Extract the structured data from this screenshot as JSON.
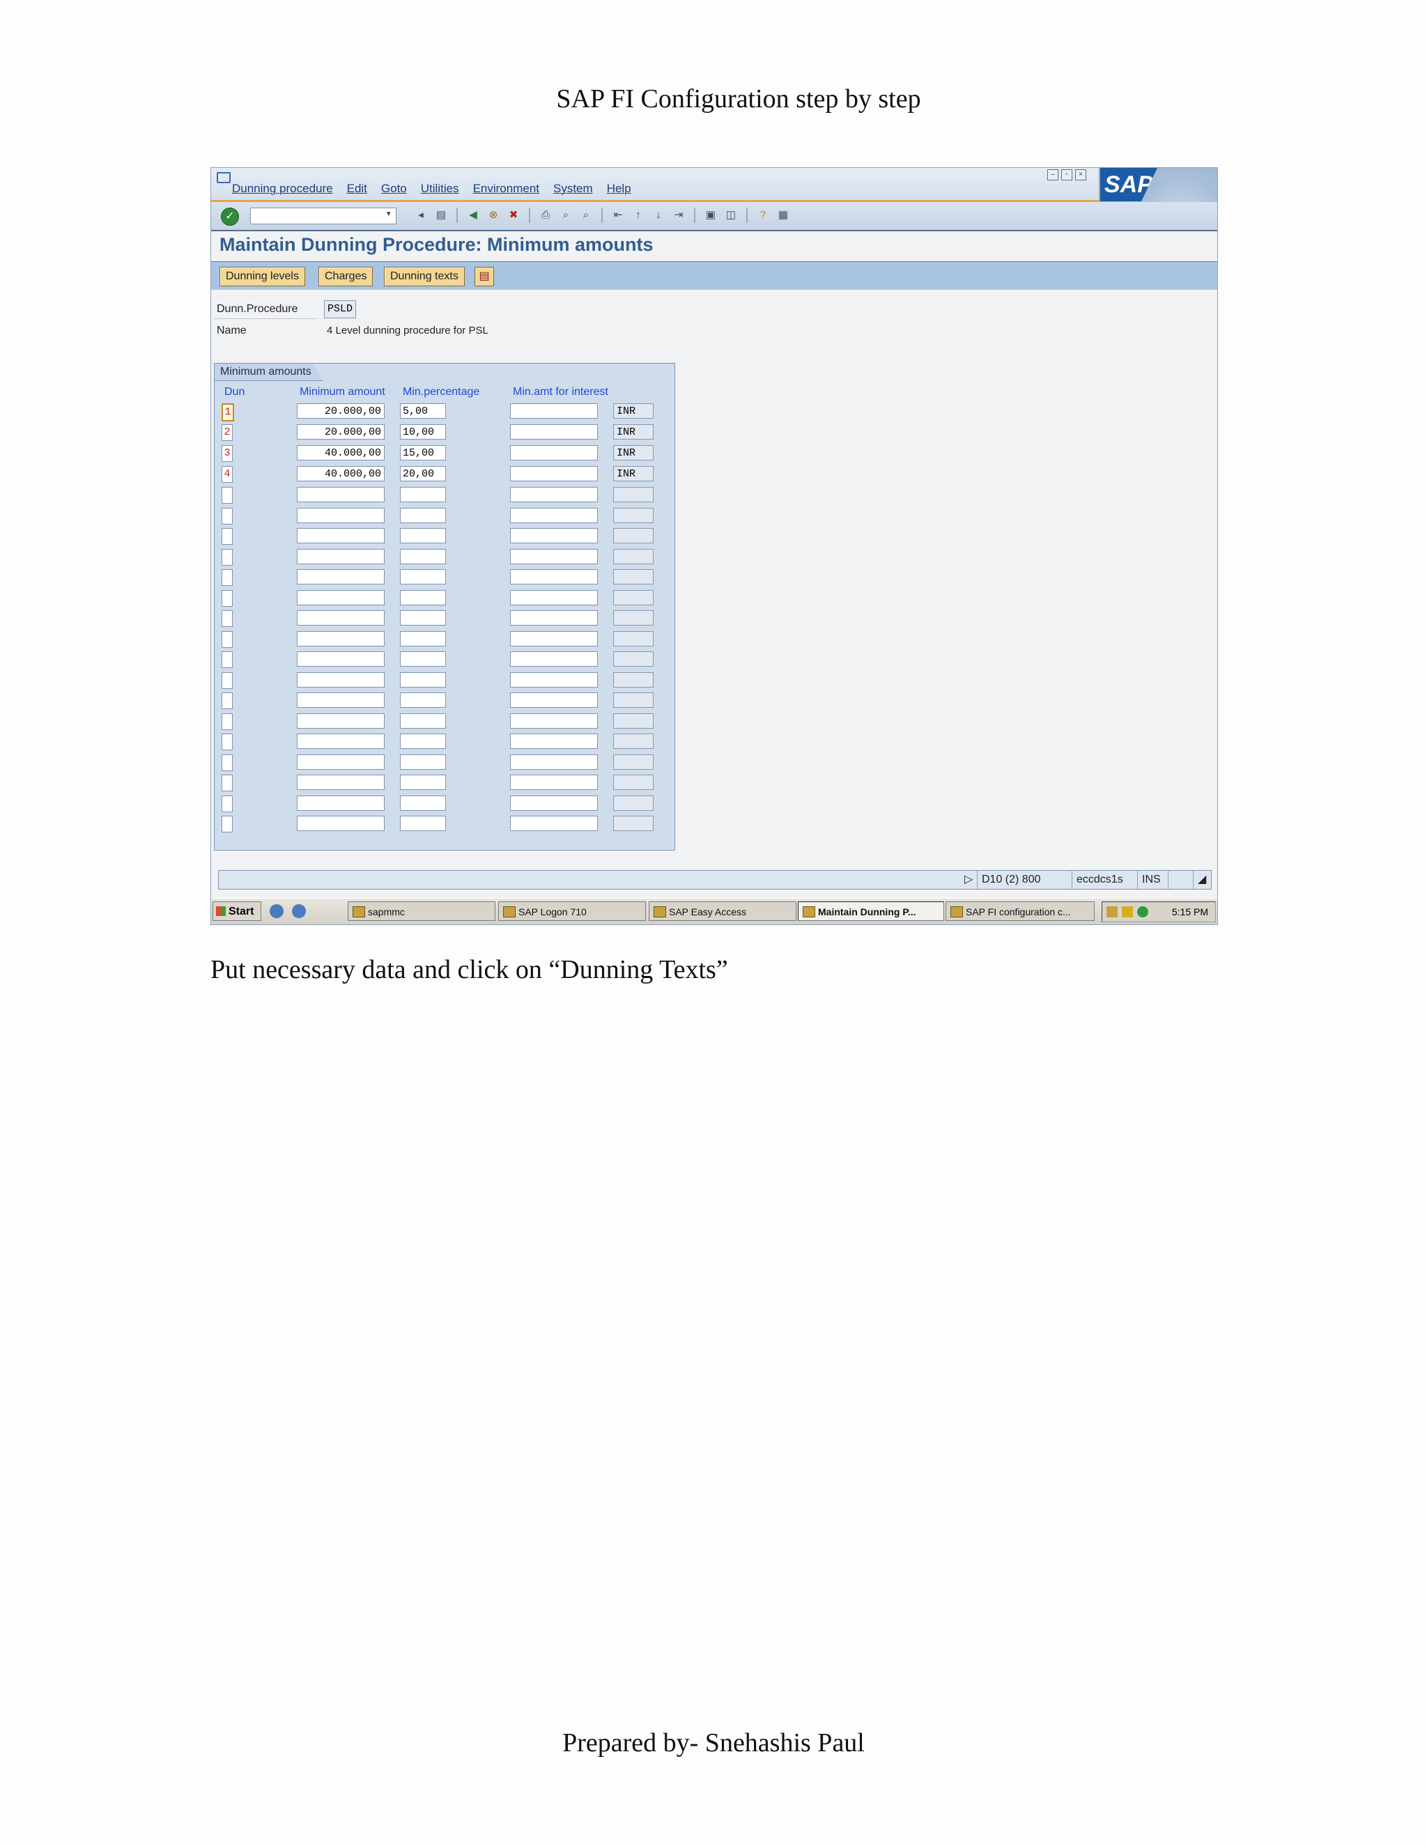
{
  "doc": {
    "title": "SAP FI Configuration step by step",
    "instruction": "Put necessary data and click on “Dunning Texts”",
    "footer": "Prepared by- Snehashis Paul"
  },
  "menu": [
    "Dunning procedure",
    "Edit",
    "Goto",
    "Utilities",
    "Environment",
    "System",
    "Help"
  ],
  "logo_text": "SAP",
  "screen_title": "Maintain Dunning Procedure: Minimum amounts",
  "app_buttons": {
    "dunning_levels": "Dunning levels",
    "charges": "Charges",
    "dunning_texts": "Dunning texts"
  },
  "header": {
    "procedure_label": "Dunn.Procedure",
    "procedure_value": "PSLD",
    "name_label": "Name",
    "name_value": "4 Level dunning procedure for PSL"
  },
  "group": {
    "title": "Minimum amounts",
    "columns": [
      "Dun",
      "Minimum amount",
      "Min.percentage",
      "Min.amt for interest"
    ],
    "rows": [
      {
        "dun": "1",
        "min_amount": "20.000,00",
        "min_pct": "5,00",
        "min_int": "",
        "currency": "INR"
      },
      {
        "dun": "2",
        "min_amount": "20.000,00",
        "min_pct": "10,00",
        "min_int": "",
        "currency": "INR"
      },
      {
        "dun": "3",
        "min_amount": "40.000,00",
        "min_pct": "15,00",
        "min_int": "",
        "currency": "INR"
      },
      {
        "dun": "4",
        "min_amount": "40.000,00",
        "min_pct": "20,00",
        "min_int": "",
        "currency": "INR"
      }
    ],
    "empty_row_count": 17
  },
  "status": {
    "system": "D10 (2) 800",
    "server": "eccdcs1s",
    "mode": "INS"
  },
  "taskbar": {
    "start": "Start",
    "tasks": [
      "sapmmc",
      "SAP Logon 710",
      "SAP Easy Access",
      "Maintain Dunning P...",
      "SAP FI configuration c..."
    ],
    "active_task": "Maintain Dunning P...",
    "clock": "5:15 PM"
  },
  "colors": {
    "title_blue": "#2f5e92",
    "column_header_blue": "#1f4bd0",
    "button_yellow": "#f2d894",
    "group_bg": "#cfdcec",
    "dun_red": "#c82020"
  },
  "icons": [
    "enter-icon",
    "back-icon",
    "exit-icon",
    "cancel-icon",
    "print-icon",
    "find-icon",
    "help-icon"
  ]
}
